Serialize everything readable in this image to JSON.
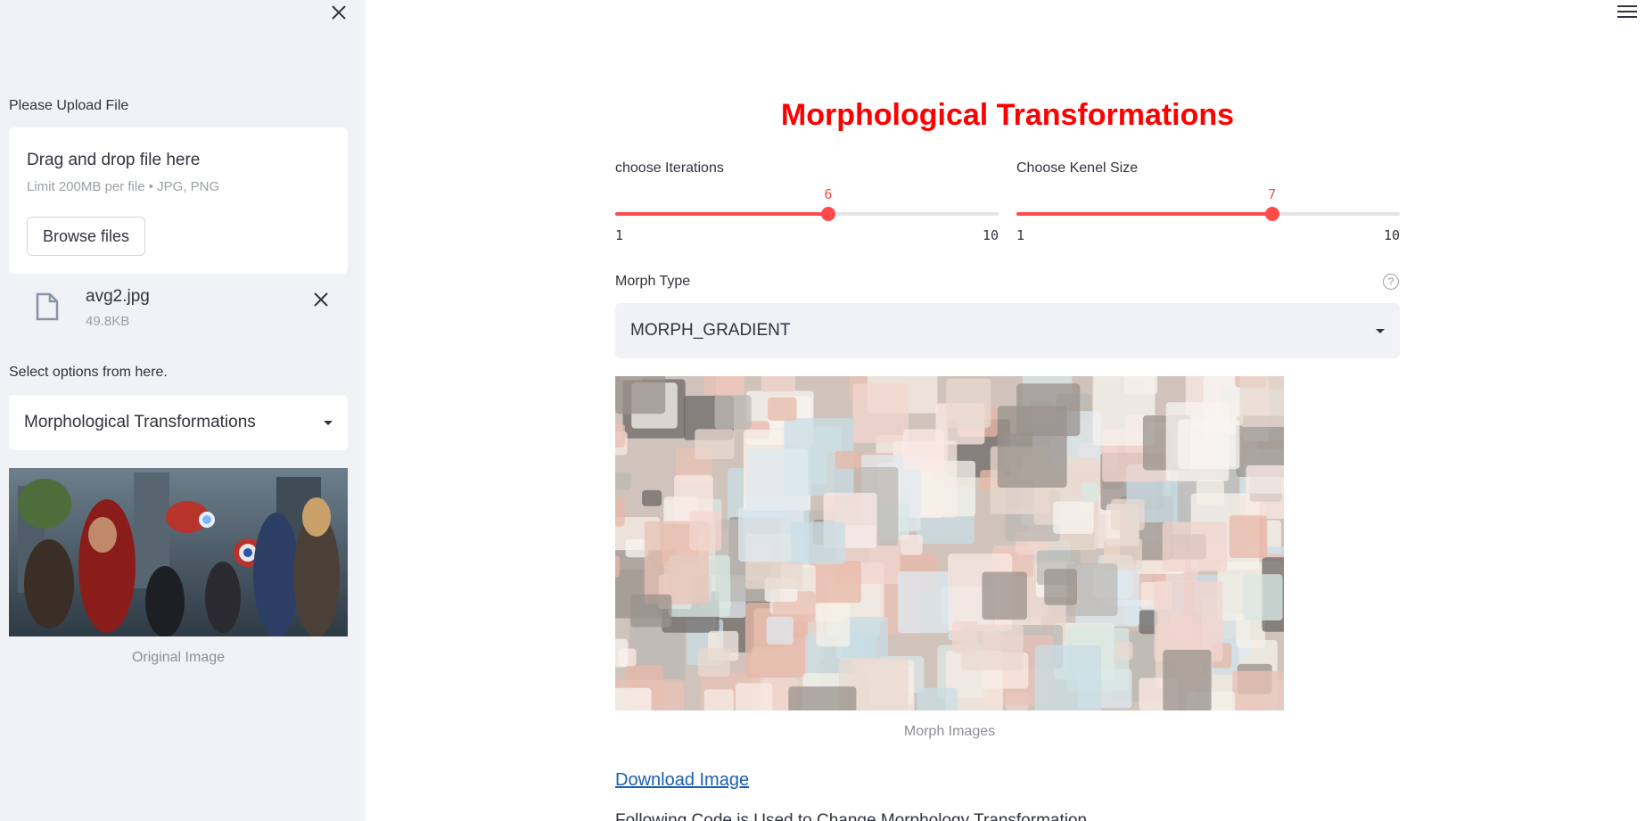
{
  "sidebar": {
    "upload_label": "Please Upload File",
    "uploader": {
      "title": "Drag and drop file here",
      "limit": "Limit 200MB per file • JPG, PNG",
      "browse_label": "Browse files"
    },
    "file": {
      "name": "avg2.jpg",
      "size": "49.8KB"
    },
    "select_label": "Select options from here.",
    "select_value": "Morphological Transformations",
    "image_caption": "Original Image"
  },
  "main": {
    "title": "Morphological Transformations",
    "iterations": {
      "label": "choose Iterations",
      "value": 6,
      "min": 1,
      "max": 10
    },
    "kernel": {
      "label": "Choose Kenel Size",
      "value": 7,
      "min": 1,
      "max": 10
    },
    "morph_type_label": "Morph Type",
    "morph_type_value": "MORPH_GRADIENT",
    "image_caption": "Morph Images",
    "download_label": "Download Image",
    "cut_text": "Following Code is Used to Change Morphology Transformation"
  },
  "colors": {
    "accent": "#ff4b4b",
    "title": "#ff0000",
    "sidebar_bg": "#f0f2f6",
    "link": "#1a5fb4"
  }
}
